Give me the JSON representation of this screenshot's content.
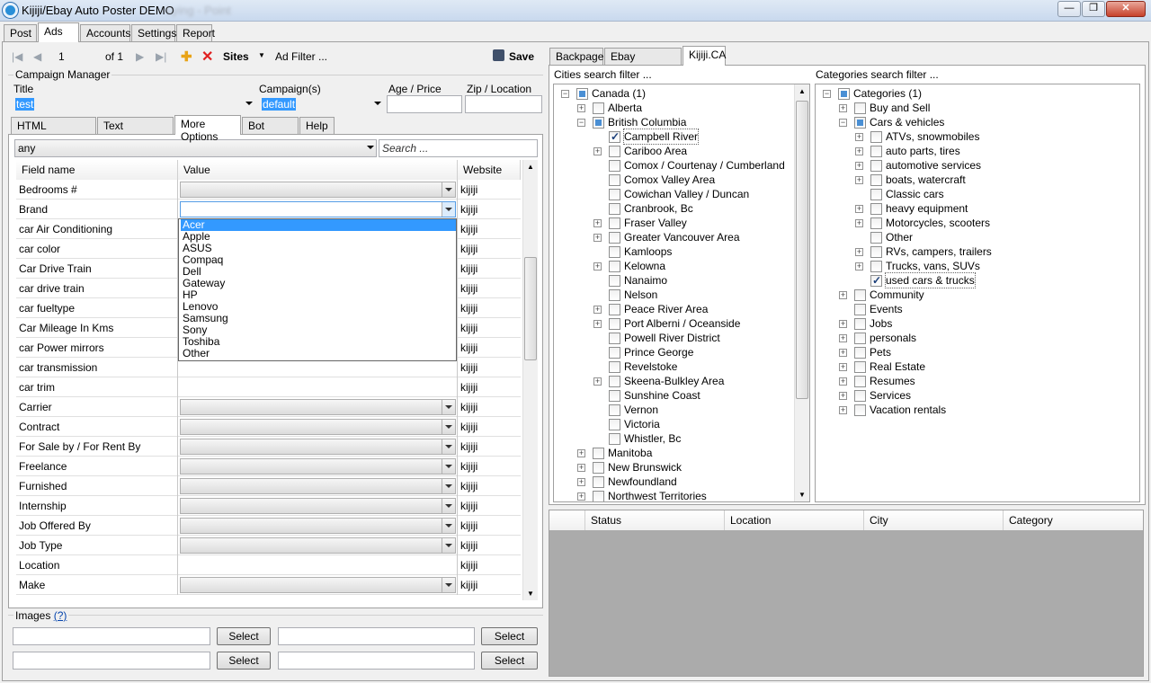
{
  "window": {
    "title": "Kijiji/Ebay Auto Poster  DEMO",
    "title_blurred": "Lying - Point",
    "min": "—",
    "max": "❐",
    "close": "✕"
  },
  "main_tabs": [
    "Post",
    "Ads",
    "Accounts",
    "Settings",
    "Report"
  ],
  "toolbar": {
    "first": "|◀",
    "prev": "◀",
    "page": "1",
    "of": "of 1",
    "next": "▶",
    "last": "▶|",
    "add": "✚",
    "delete": "✕",
    "sites": "Sites",
    "ad_filter": "Ad Filter ...",
    "save": "Save"
  },
  "campaign": {
    "group_title": "Campaign Manager",
    "title_label": "Title",
    "title_value": "test",
    "campaigns_label": "Campaign(s)",
    "campaigns_value": "default",
    "age_label": "Age / Price",
    "zip_label": "Zip / Location"
  },
  "sub_tabs": [
    "HTML description",
    "Text description",
    "More Options",
    "Bot Coding",
    "Help"
  ],
  "filter": {
    "value": "any",
    "search_placeholder": "Search ..."
  },
  "grid": {
    "headers": [
      "Field name",
      "Value",
      "Website"
    ],
    "rows": [
      {
        "field": "Bedrooms #",
        "combo": true,
        "site": "kijiji"
      },
      {
        "field": "Brand",
        "combo": false,
        "site": "kijiji"
      },
      {
        "field": "car Air Conditioning",
        "combo": false,
        "site": "kijiji"
      },
      {
        "field": "car color",
        "combo": false,
        "site": "kijiji"
      },
      {
        "field": "Car Drive Train",
        "combo": false,
        "site": "kijiji"
      },
      {
        "field": "car drive train",
        "combo": false,
        "site": "kijiji"
      },
      {
        "field": "car fueltype",
        "combo": false,
        "site": "kijiji"
      },
      {
        "field": "Car Mileage In Kms",
        "combo": false,
        "site": "kijiji"
      },
      {
        "field": "car Power mirrors",
        "combo": false,
        "site": "kijiji"
      },
      {
        "field": "car transmission",
        "combo": false,
        "site": "kijiji"
      },
      {
        "field": "car trim",
        "combo": false,
        "site": "kijiji"
      },
      {
        "field": "Carrier",
        "combo": true,
        "site": "kijiji"
      },
      {
        "field": "Contract",
        "combo": true,
        "site": "kijiji"
      },
      {
        "field": "For Sale by / For Rent By",
        "combo": true,
        "site": "kijiji"
      },
      {
        "field": "Freelance",
        "combo": true,
        "site": "kijiji"
      },
      {
        "field": "Furnished",
        "combo": true,
        "site": "kijiji"
      },
      {
        "field": "Internship",
        "combo": true,
        "site": "kijiji"
      },
      {
        "field": "Job Offered By",
        "combo": true,
        "site": "kijiji"
      },
      {
        "field": "Job Type",
        "combo": true,
        "site": "kijiji"
      },
      {
        "field": "Location",
        "combo": false,
        "site": "kijiji"
      },
      {
        "field": "Make",
        "combo": true,
        "site": "kijiji"
      }
    ],
    "brand_options": [
      "Acer",
      "Apple",
      "ASUS",
      "Compaq",
      "Dell",
      "Gateway",
      "HP",
      "Lenovo",
      "Samsung",
      "Sony",
      "Toshiba",
      "Other"
    ],
    "brand_selected": "Acer"
  },
  "images": {
    "title": "Images",
    "help": "(?)",
    "select": "Select"
  },
  "right_tabs": [
    "Backpage",
    "Ebay Classifieds",
    "Kijiji.CA"
  ],
  "cities": {
    "filter": "Cities search filter ...",
    "items": [
      {
        "label": "Canada (1)",
        "level": 0,
        "exp": "−",
        "cb": "partial"
      },
      {
        "label": "Alberta",
        "level": 1,
        "exp": "+",
        "cb": ""
      },
      {
        "label": "British Columbia",
        "level": 1,
        "exp": "−",
        "cb": "partial"
      },
      {
        "label": "Campbell River",
        "level": 2,
        "exp": "",
        "cb": "checked"
      },
      {
        "label": "Cariboo Area",
        "level": 2,
        "exp": "+",
        "cb": ""
      },
      {
        "label": "Comox / Courtenay / Cumberland",
        "level": 2,
        "exp": "",
        "cb": ""
      },
      {
        "label": "Comox Valley Area",
        "level": 2,
        "exp": "",
        "cb": ""
      },
      {
        "label": "Cowichan Valley / Duncan",
        "level": 2,
        "exp": "",
        "cb": ""
      },
      {
        "label": "Cranbrook, Bc",
        "level": 2,
        "exp": "",
        "cb": ""
      },
      {
        "label": "Fraser Valley",
        "level": 2,
        "exp": "+",
        "cb": ""
      },
      {
        "label": "Greater Vancouver Area",
        "level": 2,
        "exp": "+",
        "cb": ""
      },
      {
        "label": "Kamloops",
        "level": 2,
        "exp": "",
        "cb": ""
      },
      {
        "label": "Kelowna",
        "level": 2,
        "exp": "+",
        "cb": ""
      },
      {
        "label": "Nanaimo",
        "level": 2,
        "exp": "",
        "cb": ""
      },
      {
        "label": "Nelson",
        "level": 2,
        "exp": "",
        "cb": ""
      },
      {
        "label": "Peace River Area",
        "level": 2,
        "exp": "+",
        "cb": ""
      },
      {
        "label": "Port Alberni / Oceanside",
        "level": 2,
        "exp": "+",
        "cb": ""
      },
      {
        "label": "Powell River District",
        "level": 2,
        "exp": "",
        "cb": ""
      },
      {
        "label": "Prince George",
        "level": 2,
        "exp": "",
        "cb": ""
      },
      {
        "label": "Revelstoke",
        "level": 2,
        "exp": "",
        "cb": ""
      },
      {
        "label": "Skeena-Bulkley Area",
        "level": 2,
        "exp": "+",
        "cb": ""
      },
      {
        "label": "Sunshine Coast",
        "level": 2,
        "exp": "",
        "cb": ""
      },
      {
        "label": "Vernon",
        "level": 2,
        "exp": "",
        "cb": ""
      },
      {
        "label": "Victoria",
        "level": 2,
        "exp": "",
        "cb": ""
      },
      {
        "label": "Whistler, Bc",
        "level": 2,
        "exp": "",
        "cb": ""
      },
      {
        "label": "Manitoba",
        "level": 1,
        "exp": "+",
        "cb": ""
      },
      {
        "label": "New Brunswick",
        "level": 1,
        "exp": "+",
        "cb": ""
      },
      {
        "label": "Newfoundland",
        "level": 1,
        "exp": "+",
        "cb": ""
      },
      {
        "label": "Northwest Territories",
        "level": 1,
        "exp": "+",
        "cb": ""
      }
    ]
  },
  "categories": {
    "filter": "Categories search filter ...",
    "items": [
      {
        "label": "Categories (1)",
        "level": 0,
        "exp": "−",
        "cb": "partial"
      },
      {
        "label": "Buy and Sell",
        "level": 1,
        "exp": "+",
        "cb": ""
      },
      {
        "label": "Cars & vehicles",
        "level": 1,
        "exp": "−",
        "cb": "partial"
      },
      {
        "label": "ATVs, snowmobiles",
        "level": 2,
        "exp": "+",
        "cb": ""
      },
      {
        "label": "auto parts, tires",
        "level": 2,
        "exp": "+",
        "cb": ""
      },
      {
        "label": "automotive services",
        "level": 2,
        "exp": "+",
        "cb": ""
      },
      {
        "label": "boats, watercraft",
        "level": 2,
        "exp": "+",
        "cb": ""
      },
      {
        "label": "Classic cars",
        "level": 2,
        "exp": "",
        "cb": ""
      },
      {
        "label": "heavy equipment",
        "level": 2,
        "exp": "+",
        "cb": ""
      },
      {
        "label": "Motorcycles, scooters",
        "level": 2,
        "exp": "+",
        "cb": ""
      },
      {
        "label": "Other",
        "level": 2,
        "exp": "",
        "cb": ""
      },
      {
        "label": "RVs, campers, trailers",
        "level": 2,
        "exp": "+",
        "cb": ""
      },
      {
        "label": "Trucks, vans, SUVs",
        "level": 2,
        "exp": "+",
        "cb": ""
      },
      {
        "label": "used cars & trucks",
        "level": 2,
        "exp": "",
        "cb": "checked"
      },
      {
        "label": "Community",
        "level": 1,
        "exp": "+",
        "cb": ""
      },
      {
        "label": "Events",
        "level": 1,
        "exp": "",
        "cb": ""
      },
      {
        "label": "Jobs",
        "level": 1,
        "exp": "+",
        "cb": ""
      },
      {
        "label": "personals",
        "level": 1,
        "exp": "+",
        "cb": ""
      },
      {
        "label": "Pets",
        "level": 1,
        "exp": "+",
        "cb": ""
      },
      {
        "label": "Real Estate",
        "level": 1,
        "exp": "+",
        "cb": ""
      },
      {
        "label": "Resumes",
        "level": 1,
        "exp": "+",
        "cb": ""
      },
      {
        "label": "Services",
        "level": 1,
        "exp": "+",
        "cb": ""
      },
      {
        "label": "Vacation rentals",
        "level": 1,
        "exp": "+",
        "cb": ""
      }
    ]
  },
  "status_grid": {
    "headers": [
      "Status",
      "Location",
      "City",
      "Category"
    ]
  }
}
